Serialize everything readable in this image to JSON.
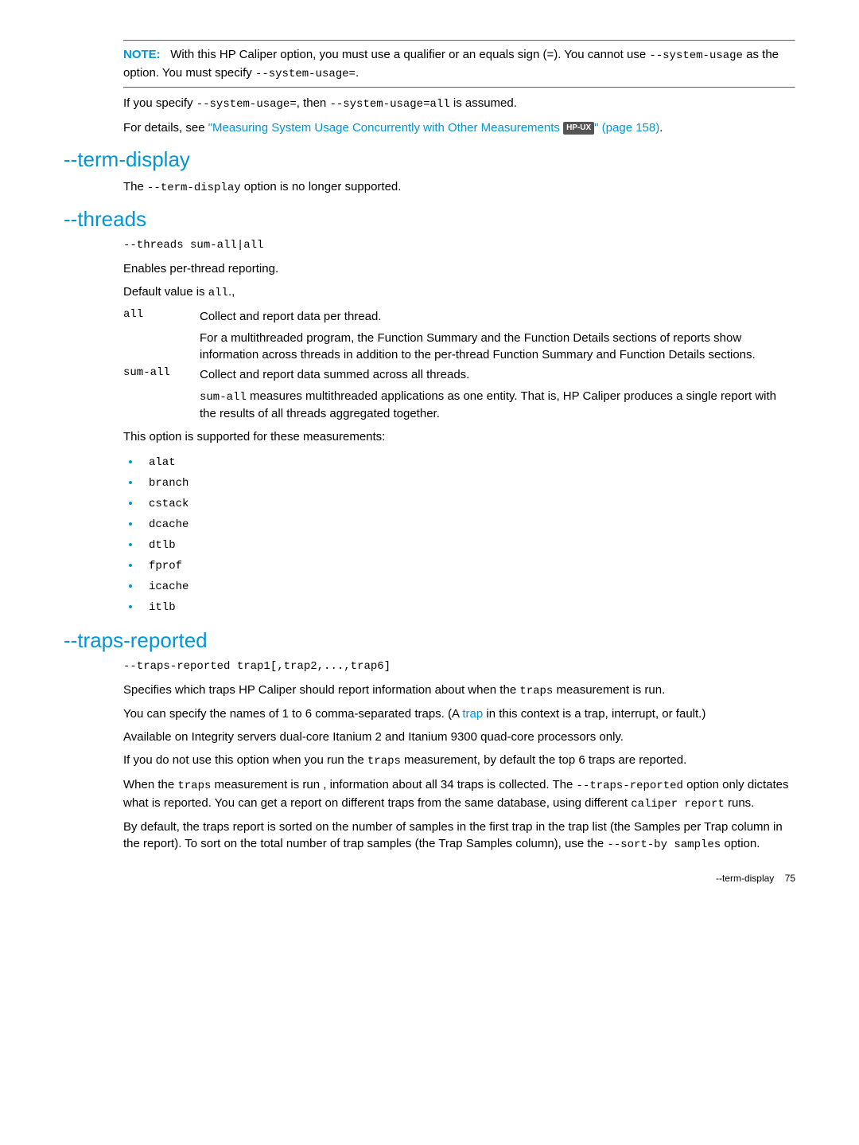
{
  "note": {
    "label": "NOTE:",
    "body_a": "With this HP Caliper option, you must use a qualifier or an equals sign (=). You cannot use ",
    "body_code1": "--system-usage",
    "body_b": " as the option. You must specify ",
    "body_code2": "--system-usage=",
    "body_c": "."
  },
  "spec": {
    "a": "If you specify ",
    "code1": "--system-usage=",
    "b": ", then ",
    "code2": "--system-usage=all",
    "c": " is assumed."
  },
  "details": {
    "a": "For details, see ",
    "link_pre": "\"Measuring System Usage Concurrently with Other Measurements ",
    "badge": "HP-UX",
    "link_post": "\" (page 158)",
    "c": "."
  },
  "term_display": {
    "heading": "--term-display",
    "a": "The ",
    "code": "--term-display",
    "b": " option is no longer supported."
  },
  "threads": {
    "heading": "--threads",
    "syntax": "--threads sum-all|all",
    "enables": "Enables per-thread reporting.",
    "default_a": "Default value is ",
    "default_code": "all",
    "default_b": ".,",
    "dl": {
      "all_dt": "all",
      "all_dd1": "Collect and report data per thread.",
      "all_dd2": "For a multithreaded program, the Function Summary and the Function Details sections of reports show information across threads in addition to the per-thread Function Summary and Function Details sections.",
      "sum_dt": "sum-all",
      "sum_dd1": "Collect and report data summed across all threads.",
      "sum_dd2_code": "sum-all",
      "sum_dd2_a": " measures multithreaded applications as one entity. That is, HP Caliper produces a single report with the results of all threads aggregated together."
    },
    "supported_intro": "This option is supported for these measurements:",
    "measurements": [
      "alat",
      "branch",
      "cstack",
      "dcache",
      "dtlb",
      "fprof",
      "icache",
      "itlb"
    ]
  },
  "traps": {
    "heading": "--traps-reported",
    "syntax": "--traps-reported trap1[,trap2,...,trap6]",
    "p1_a": "Specifies which traps HP Caliper should report information about when the ",
    "p1_code": "traps",
    "p1_b": " measurement is run.",
    "p2_a": "You can specify the names of 1 to 6 comma-separated traps. (A ",
    "p2_link": "trap",
    "p2_b": " in this context is a trap, interrupt, or fault.)",
    "p3": "Available on Integrity servers dual-core Itanium 2 and Itanium 9300 quad-core processors only.",
    "p4_a": "If you do not use this option when you run the ",
    "p4_code": "traps",
    "p4_b": " measurement, by default the top 6 traps are reported.",
    "p5_a": "When the ",
    "p5_code1": "traps",
    "p5_b": " measurement is run , information about all 34 traps is collected. The ",
    "p5_code2": "--traps-reported",
    "p5_c": " option only dictates what is reported. You can get a report on different traps from the same database, using different ",
    "p5_code3": "caliper report",
    "p5_d": " runs.",
    "p6_a": "By default, the traps report is sorted on the number of samples in the first trap in the trap list (the Samples per Trap column in the report). To sort on the total number of trap samples (the Trap Samples column), use the ",
    "p6_code": "--sort-by samples",
    "p6_b": " option."
  },
  "footer": {
    "section": "--term-display",
    "page": "75"
  }
}
